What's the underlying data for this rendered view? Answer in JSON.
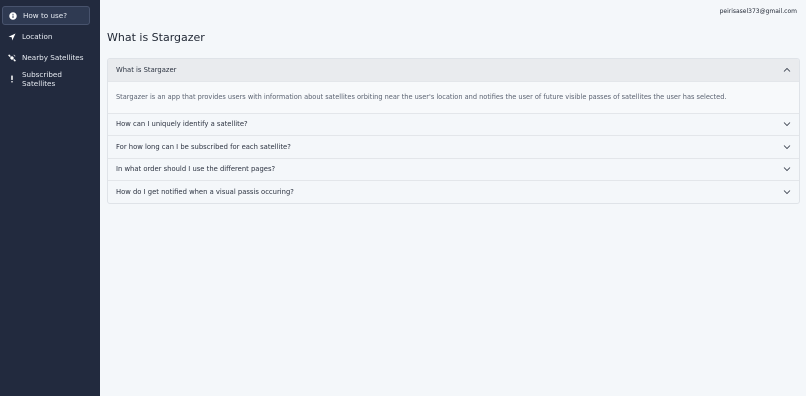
{
  "sidebar": {
    "items": [
      {
        "label": "How to use?",
        "icon": "info-circle-icon",
        "active": true
      },
      {
        "label": "Location",
        "icon": "location-arrow-icon",
        "active": false
      },
      {
        "label": "Nearby Satellites",
        "icon": "satellite-icon",
        "active": false
      },
      {
        "label": "Subscribed Satellites",
        "icon": "exclamation-icon",
        "active": false
      }
    ]
  },
  "header": {
    "user_email": "peirisasel373@gmail.com",
    "title": "What is Stargazer"
  },
  "faq": [
    {
      "question": "What is Stargazer",
      "expanded": true,
      "answer": "Stargazer is an app that provides users with information about satellites orbiting near the user's location and notifies the user of future visible passes of satellites the user has selected."
    },
    {
      "question": "How can I uniquely identify a satellite?",
      "expanded": false
    },
    {
      "question": "For how long can I be subscribed for each satellite?",
      "expanded": false
    },
    {
      "question": "In what order should I use the different pages?",
      "expanded": false
    },
    {
      "question": "How do I get notified when a visual passis occuring?",
      "expanded": false
    }
  ]
}
